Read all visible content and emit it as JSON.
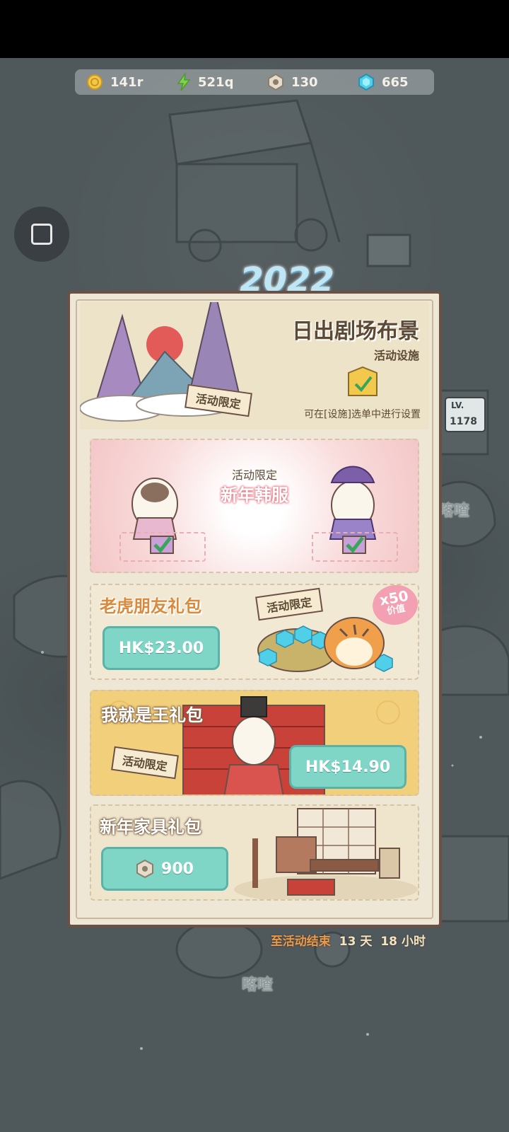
{
  "currencies": [
    {
      "icon": "gold-coin-icon",
      "value": "141r"
    },
    {
      "icon": "lightning-icon",
      "value": "521q"
    },
    {
      "icon": "nut-icon",
      "value": "130"
    },
    {
      "icon": "gem-icon",
      "value": "665"
    }
  ],
  "floating_button": {
    "icon": "square-icon"
  },
  "year_title": "2022",
  "header": {
    "title": "日出剧场布景",
    "subtitle": "活动设施",
    "limited_tag": "活动限定",
    "hint": "可在[设施]选单中进行设置"
  },
  "hanbok_card": {
    "label": "活动限定",
    "title": "新年韩服"
  },
  "tiger_pack": {
    "title": "老虎朋友礼包",
    "limited_tag": "活动限定",
    "value_badge_top": "x50",
    "value_badge_bottom": "价值",
    "price": "HK$23.00"
  },
  "king_pack": {
    "title": "我就是王礼包",
    "limited_tag": "活动限定",
    "price": "HK$14.90"
  },
  "furniture_pack": {
    "title": "新年家具礼包",
    "price": "900"
  },
  "countdown": {
    "prefix": "至活动结束",
    "days": "13",
    "days_unit": "天",
    "hours": "18",
    "hours_unit": "小时"
  },
  "background": {
    "label_right": "喀喳",
    "label_bottom": "喀喳",
    "level_sign": "1178",
    "level_prefix": "LV."
  },
  "colors": {
    "price_button": "#7fd6c7",
    "panel_border": "#6b5046",
    "pink_card": "#f9dcdc",
    "gold_card": "#f2cf7b"
  }
}
